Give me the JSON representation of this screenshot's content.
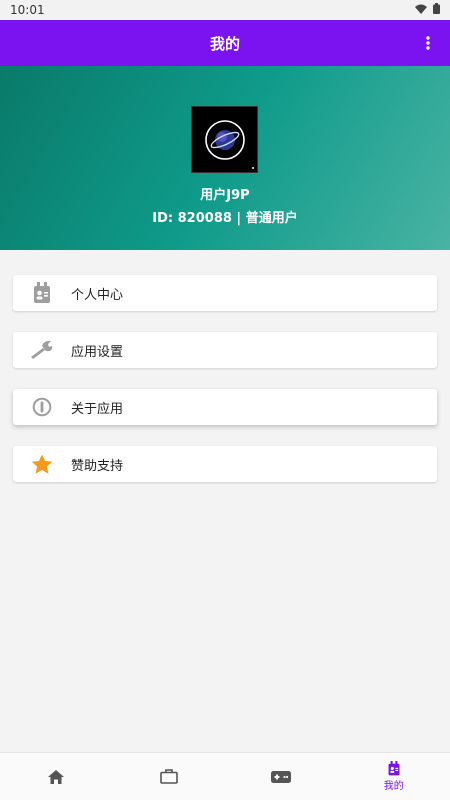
{
  "status_bar": {
    "time": "10:01",
    "icons": [
      "wifi-icon",
      "battery-icon"
    ]
  },
  "app_bar": {
    "title": "我的",
    "menu_icon": "more-vert-icon"
  },
  "profile": {
    "username": "用户J9P",
    "id_line": "ID: 820088 | 普通用户",
    "avatar_icon": "planet-icon"
  },
  "menu": {
    "items": [
      {
        "label": "个人中心",
        "icon": "badge-icon"
      },
      {
        "label": "应用设置",
        "icon": "wrench-icon"
      },
      {
        "label": "关于应用",
        "icon": "info-icon"
      },
      {
        "label": "赞助支持",
        "icon": "star-icon"
      }
    ]
  },
  "bottom_nav": {
    "active_index": 3,
    "items": [
      {
        "icon": "home-icon",
        "label": ""
      },
      {
        "icon": "briefcase-icon",
        "label": ""
      },
      {
        "icon": "gamepad-icon",
        "label": ""
      },
      {
        "icon": "badge-icon",
        "label": "我的"
      }
    ]
  },
  "colors": {
    "primary": "#7a13f0",
    "hero_start": "#0a7a6a",
    "hero_end": "#49b3a4",
    "icon_gray": "#9e9e9e",
    "star": "#f59a1b"
  }
}
